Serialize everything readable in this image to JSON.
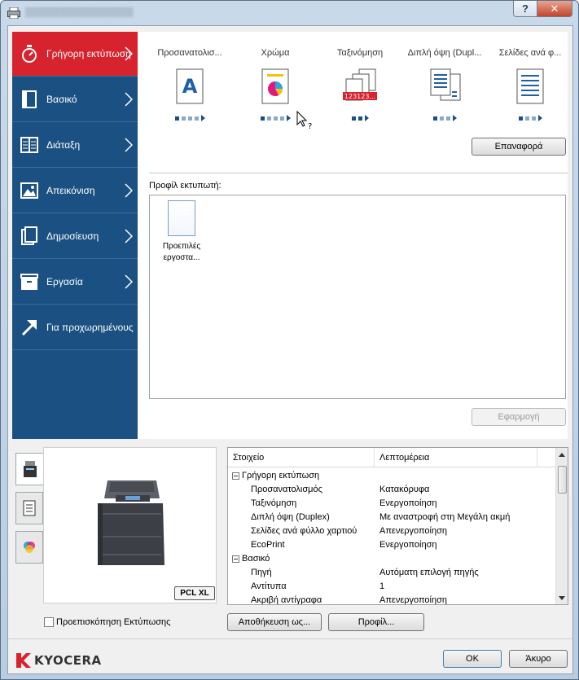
{
  "window": {
    "title": "▒▒▒▒▒▒▒▒▒▒▒▒▒▒▒▒▒",
    "help_label": "?",
    "close_label": "✕"
  },
  "sidebar": {
    "items": [
      {
        "label": "Γρήγορη εκτύπωση",
        "icon": "stopwatch-icon",
        "active": true
      },
      {
        "label": "Βασικό",
        "icon": "document-basic-icon"
      },
      {
        "label": "Διάταξη",
        "icon": "layout-icon"
      },
      {
        "label": "Απεικόνιση",
        "icon": "image-icon"
      },
      {
        "label": "Δημοσίευση",
        "icon": "publishing-icon"
      },
      {
        "label": "Εργασία",
        "icon": "job-icon"
      },
      {
        "label": "Για προχωρημένους",
        "icon": "advanced-arrow-icon"
      }
    ]
  },
  "quick_print": {
    "columns": [
      {
        "label": "Προσανατολισ...",
        "icon": "orientation-icon"
      },
      {
        "label": "Χρώμα",
        "icon": "color-icon"
      },
      {
        "label": "Ταξινόμηση",
        "icon": "collate-icon"
      },
      {
        "label": "Διπλή όψη (Dupl...",
        "icon": "duplex-icon"
      },
      {
        "label": "Σελίδες ανά φ...",
        "icon": "pages-per-sheet-icon"
      }
    ],
    "orientation_glyph": "A",
    "collate_glyph": "123123...",
    "reset_label": "Επαναφορά"
  },
  "profiles": {
    "label": "Προφίλ εκτυπωτή:",
    "items": [
      {
        "name_line1": "Προεπιλές",
        "name_line2": "εργοστα..."
      }
    ],
    "apply_label": "Εφαρμογή"
  },
  "preview": {
    "tabs": [
      "printer-preview-tab",
      "page-preview-tab",
      "color-preview-tab"
    ],
    "badge": "PCL XL",
    "checkbox_label": "Προεπισκόπηση Εκτύπωσης",
    "checkbox_checked": false
  },
  "details": {
    "columns": [
      "Στοιχείο",
      "Λεπτομέρεια"
    ],
    "rows": [
      {
        "type": "group",
        "key": "Γρήγορη εκτύπωση",
        "value": ""
      },
      {
        "type": "item",
        "key": "Προσανατολισμός",
        "value": "Κατακόρυφα"
      },
      {
        "type": "item",
        "key": "Ταξινόμηση",
        "value": "Ενεργοποίηση"
      },
      {
        "type": "item",
        "key": "Διπλή όψη (Duplex)",
        "value": "Με αναστροφή στη Μεγάλη ακμή"
      },
      {
        "type": "item",
        "key": "Σελίδες ανά φύλλο χαρτιού",
        "value": "Απενεργοποίηση"
      },
      {
        "type": "item",
        "key": "EcoPrint",
        "value": "Ενεργοποίηση"
      },
      {
        "type": "group",
        "key": "Βασικό",
        "value": ""
      },
      {
        "type": "item",
        "key": "Πηγή",
        "value": "Αυτόματη επιλογή πηγής"
      },
      {
        "type": "item",
        "key": "Αντίτυπα",
        "value": "1"
      },
      {
        "type": "item",
        "key": "Ακριβή αντίγραφα",
        "value": "Απενεργοποίηση"
      }
    ],
    "save_as_label": "Αποθήκευση ως...",
    "profile_label": "Προφίλ..."
  },
  "footer": {
    "brand": "KYOCERA",
    "ok_label": "OK",
    "cancel_label": "Άκυρο"
  },
  "colors": {
    "sidebar_bg": "#1b5083",
    "active_item": "#d6232d",
    "accent_blue": "#1f5fa8"
  }
}
